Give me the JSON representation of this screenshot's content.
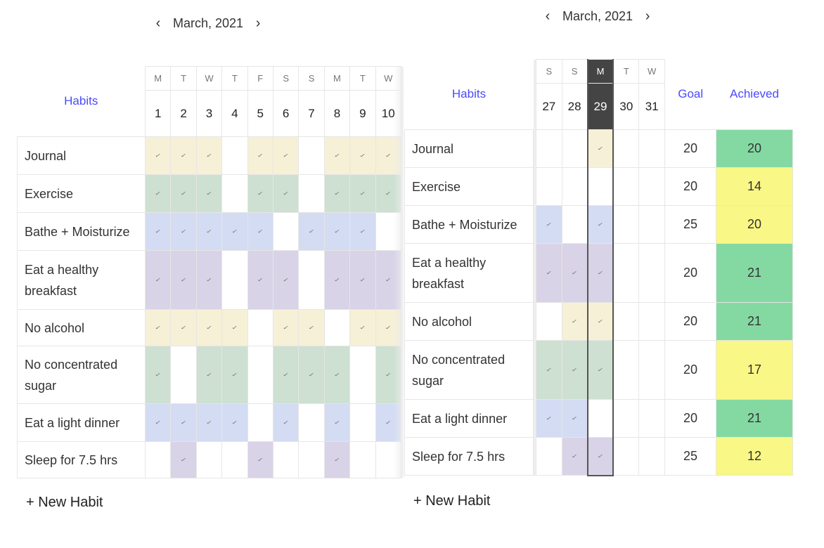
{
  "left": {
    "month_label": "March, 2021",
    "habits_header": "Habits",
    "days": [
      {
        "dow": "M",
        "date": "1"
      },
      {
        "dow": "T",
        "date": "2"
      },
      {
        "dow": "W",
        "date": "3"
      },
      {
        "dow": "T",
        "date": "4"
      },
      {
        "dow": "F",
        "date": "5"
      },
      {
        "dow": "S",
        "date": "6"
      },
      {
        "dow": "S",
        "date": "7"
      },
      {
        "dow": "M",
        "date": "8"
      },
      {
        "dow": "T",
        "date": "9"
      },
      {
        "dow": "W",
        "date": "10"
      }
    ],
    "rows": [
      {
        "name": "Journal",
        "color": "y",
        "checks": [
          1,
          1,
          1,
          0,
          1,
          1,
          0,
          1,
          1,
          1
        ]
      },
      {
        "name": "Exercise",
        "color": "g",
        "checks": [
          1,
          1,
          1,
          0,
          1,
          1,
          0,
          1,
          1,
          1
        ]
      },
      {
        "name": "Bathe + Moisturize",
        "color": "b",
        "checks": [
          1,
          1,
          1,
          1,
          1,
          0,
          1,
          1,
          1,
          0
        ]
      },
      {
        "name": "Eat a healthy breakfast",
        "color": "p",
        "checks": [
          1,
          1,
          1,
          0,
          1,
          1,
          0,
          1,
          1,
          1
        ]
      },
      {
        "name": "No alcohol",
        "color": "y",
        "checks": [
          1,
          1,
          1,
          1,
          0,
          1,
          1,
          0,
          1,
          1
        ]
      },
      {
        "name": "No concentrated sugar",
        "color": "g",
        "checks": [
          1,
          0,
          1,
          1,
          0,
          1,
          1,
          1,
          0,
          1
        ]
      },
      {
        "name": "Eat a light dinner",
        "color": "b",
        "checks": [
          1,
          1,
          1,
          1,
          0,
          1,
          0,
          1,
          0,
          1
        ]
      },
      {
        "name": "Sleep for 7.5 hrs",
        "color": "p",
        "checks": [
          0,
          1,
          0,
          0,
          1,
          0,
          0,
          1,
          0,
          0
        ]
      }
    ],
    "new_habit_label": "+ New Habit"
  },
  "right": {
    "month_label": "March, 2021",
    "habits_header": "Habits",
    "goal_header": "Goal",
    "achieved_header": "Achieved",
    "days": [
      {
        "dow": "S",
        "date": "27"
      },
      {
        "dow": "S",
        "date": "28"
      },
      {
        "dow": "M",
        "date": "29",
        "today": true
      },
      {
        "dow": "T",
        "date": "30"
      },
      {
        "dow": "W",
        "date": "31"
      }
    ],
    "rows": [
      {
        "name": "Journal",
        "color": "y",
        "checks": [
          0,
          0,
          1,
          0,
          0
        ],
        "goal": "20",
        "achieved": "20",
        "status": "green"
      },
      {
        "name": "Exercise",
        "color": "g",
        "checks": [
          0,
          0,
          0,
          0,
          0
        ],
        "goal": "20",
        "achieved": "14",
        "status": "yellow"
      },
      {
        "name": "Bathe + Moisturize",
        "color": "b",
        "checks": [
          1,
          0,
          1,
          0,
          0
        ],
        "goal": "25",
        "achieved": "20",
        "status": "yellow"
      },
      {
        "name": "Eat a healthy breakfast",
        "color": "p",
        "checks": [
          1,
          1,
          1,
          0,
          0
        ],
        "goal": "20",
        "achieved": "21",
        "status": "green"
      },
      {
        "name": "No alcohol",
        "color": "y",
        "checks": [
          0,
          1,
          1,
          0,
          0
        ],
        "goal": "20",
        "achieved": "21",
        "status": "green"
      },
      {
        "name": "No concentrated sugar",
        "color": "g",
        "checks": [
          1,
          1,
          1,
          0,
          0
        ],
        "goal": "20",
        "achieved": "17",
        "status": "yellow"
      },
      {
        "name": "Eat a light dinner",
        "color": "b",
        "checks": [
          1,
          1,
          0,
          0,
          0
        ],
        "goal": "20",
        "achieved": "21",
        "status": "green"
      },
      {
        "name": "Sleep for 7.5 hrs",
        "color": "p",
        "checks": [
          0,
          1,
          1,
          0,
          0
        ],
        "goal": "25",
        "achieved": "12",
        "status": "yellow"
      }
    ],
    "new_habit_label": "+ New Habit"
  },
  "icons": {
    "prev": "chevron-left-icon",
    "next": "chevron-right-icon",
    "check": "checkmark-icon"
  },
  "colors": {
    "accent_blue": "#4a4aff",
    "yellow": "#f6f0d7",
    "green": "#cde0d2",
    "blue": "#d3dcf3",
    "purple": "#d9d3e7",
    "achieved_green": "#84d9a3",
    "achieved_yellow": "#f9f785",
    "today": "#444444"
  }
}
